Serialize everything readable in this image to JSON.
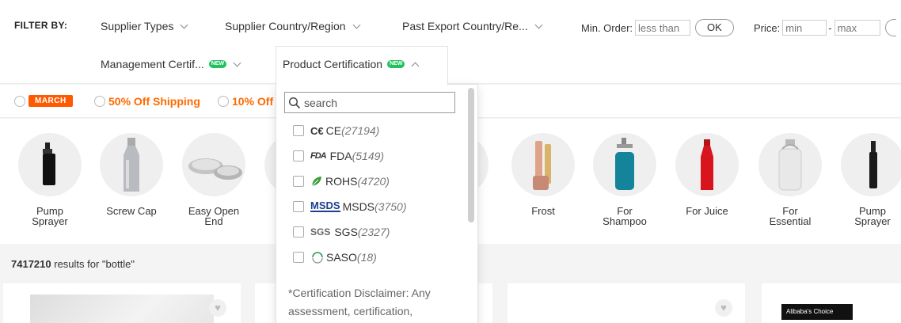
{
  "filter_bar": {
    "label": "FILTER BY:",
    "supplier_types": "Supplier Types",
    "supplier_country": "Supplier Country/Region",
    "past_export": "Past Export Country/Re...",
    "min_order_label": "Min. Order:",
    "min_order_placeholder": "less than",
    "ok": "OK",
    "price_label": "Price:",
    "price_min_placeholder": "min",
    "price_dash": "-",
    "price_max_placeholder": "max",
    "management_cert": "Management Certif...",
    "product_cert": "Product Certification",
    "new_badge": "NEW"
  },
  "promos": {
    "march": "MARCH",
    "half_off_shipping": "50% Off Shipping",
    "ten_off": "10% Off"
  },
  "categories": [
    {
      "label": "Pump\nSprayer"
    },
    {
      "label": "Screw Cap"
    },
    {
      "label": "Easy Open\nEnd"
    },
    {
      "label": "Frost"
    },
    {
      "label": "For\nShampoo"
    },
    {
      "label": "For Juice"
    },
    {
      "label": "For\nEssential"
    },
    {
      "label": "Pump\nSprayer"
    }
  ],
  "results": {
    "count": "7417210",
    "text": " results for \"bottle\""
  },
  "dropdown": {
    "search_placeholder": "search",
    "options": [
      {
        "logo": "C€",
        "name": "CE",
        "count": "(27194)"
      },
      {
        "logo": "FDA",
        "name": "FDA",
        "count": "(5149)"
      },
      {
        "logo": "",
        "name": "ROHS",
        "count": "(4720)"
      },
      {
        "logo": "MSDS",
        "name": "MSDS",
        "count": "(3750)"
      },
      {
        "logo": "SGS",
        "name": "SGS",
        "count": "(2327)"
      },
      {
        "logo": "",
        "name": "SASO",
        "count": "(18)"
      }
    ],
    "disclaimer": "*Certification Disclaimer: Any assessment, certification,"
  },
  "card": {
    "alibaba_choice": "Alibaba's Choice"
  },
  "colors": {
    "accent": "#ff6a00",
    "new_badge": "#21c25e"
  }
}
